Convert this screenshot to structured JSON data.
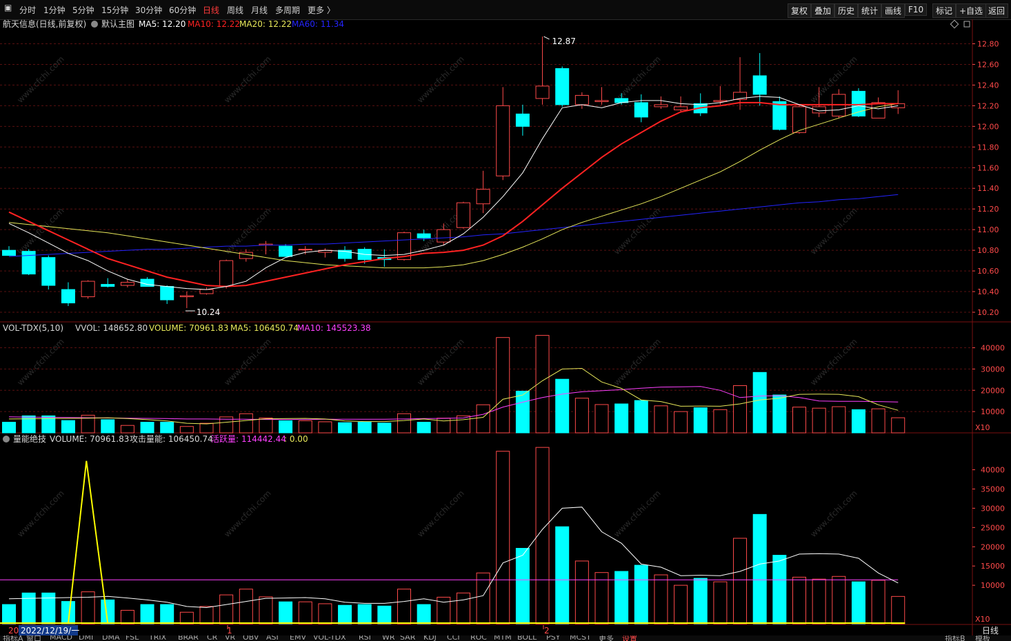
{
  "toolbar": {
    "periods": [
      "分时",
      "1分钟",
      "5分钟",
      "15分钟",
      "30分钟",
      "60分钟",
      "日线",
      "周线",
      "月线",
      "多周期",
      "更多 〉"
    ],
    "active_period": "日线",
    "right_buttons": [
      "复权",
      "叠加",
      "历史",
      "统计",
      "画线",
      "F10",
      "标记",
      "+自选",
      "返回"
    ]
  },
  "main_panel": {
    "stock_title": "航天信息(日线,前复权)",
    "chart_label": "默认主图",
    "ma5": "MA5: 12.20",
    "ma10": "MA10: 12.22",
    "ma20": "MA20: 12.22",
    "ma60": "MA60: 11.34",
    "high_marker": "12.87",
    "low_marker": "10.24",
    "y_ticks": [
      "12.80",
      "12.60",
      "12.40",
      "12.20",
      "12.00",
      "11.80",
      "11.60",
      "11.40",
      "11.20",
      "11.00",
      "10.80",
      "10.60",
      "10.40",
      "10.20"
    ]
  },
  "vol_panel": {
    "title": "VOL-TDX(5,10)",
    "vvol": "VVOL: 148652.80",
    "volume": "VOLUME: 70961.83",
    "ma5": "MA5: 106450.74",
    "ma10": "MA10: 145523.38",
    "y_ticks": [
      "40000",
      "30000",
      "20000",
      "10000"
    ],
    "unit": "X10"
  },
  "energy_panel": {
    "title": "量能绝技",
    "volume": "VOLUME: 70961.83",
    "attack": "攻击量能: 106450.74",
    "active_label": "活跃量: ",
    "active_value": "114442.44",
    "tail": ": 0.00",
    "y_ticks": [
      "40000",
      "35000",
      "30000",
      "25000",
      "20000",
      "15000",
      "10000"
    ],
    "unit": "X10"
  },
  "x_axis": {
    "left_edge": "20",
    "date_cursor": "2022/12/19/一",
    "mark_1": "1",
    "mark_2": "2",
    "period_label": "日线"
  },
  "bottom_tabs": [
    "指标A",
    "窗口",
    "MACD",
    "DMI",
    "DMA",
    "FSL",
    "TRIX",
    "BRAR",
    "CR",
    "VR",
    "OBV",
    "ASI",
    "EMV",
    "VOL-TDX",
    "RSI",
    "WR",
    "SAR",
    "KDJ",
    "CCI",
    "ROC",
    "MTM",
    "BOLL",
    "PSY",
    "MCST",
    "更多",
    "设置"
  ],
  "bottom_right": [
    "指标B",
    "模板"
  ],
  "watermark": "www.cfchi.com",
  "colors": {
    "up": "#ff4a4a",
    "down": "#00ffff",
    "ma5": "#ffffff",
    "ma10": "#ff2222",
    "ma20": "#e8e85a",
    "ma60": "#2424ff",
    "vol_ma10": "#ff40ff",
    "bg": "#000000"
  },
  "chart_data": {
    "type": "candlestick",
    "price_ylim": [
      10.1,
      12.93
    ],
    "candles": [
      {
        "o": 10.8,
        "h": 10.84,
        "l": 10.75,
        "c": 10.75
      },
      {
        "o": 10.79,
        "h": 10.81,
        "l": 10.56,
        "c": 10.57
      },
      {
        "o": 10.73,
        "h": 10.75,
        "l": 10.42,
        "c": 10.46
      },
      {
        "o": 10.42,
        "h": 10.49,
        "l": 10.26,
        "c": 10.29
      },
      {
        "o": 10.35,
        "h": 10.51,
        "l": 10.33,
        "c": 10.5
      },
      {
        "o": 10.47,
        "h": 10.53,
        "l": 10.44,
        "c": 10.45
      },
      {
        "o": 10.46,
        "h": 10.52,
        "l": 10.44,
        "c": 10.49
      },
      {
        "o": 10.52,
        "h": 10.54,
        "l": 10.45,
        "c": 10.45
      },
      {
        "o": 10.45,
        "h": 10.46,
        "l": 10.28,
        "c": 10.32
      },
      {
        "o": 10.35,
        "h": 10.4,
        "l": 10.24,
        "c": 10.36
      },
      {
        "o": 10.38,
        "h": 10.44,
        "l": 10.37,
        "c": 10.42
      },
      {
        "o": 10.45,
        "h": 10.71,
        "l": 10.43,
        "c": 10.7
      },
      {
        "o": 10.72,
        "h": 10.81,
        "l": 10.69,
        "c": 10.78
      },
      {
        "o": 10.85,
        "h": 10.89,
        "l": 10.76,
        "c": 10.86
      },
      {
        "o": 10.84,
        "h": 10.86,
        "l": 10.74,
        "c": 10.74
      },
      {
        "o": 10.81,
        "h": 10.84,
        "l": 10.76,
        "c": 10.81
      },
      {
        "o": 10.78,
        "h": 10.82,
        "l": 10.73,
        "c": 10.8
      },
      {
        "o": 10.8,
        "h": 10.84,
        "l": 10.69,
        "c": 10.72
      },
      {
        "o": 10.81,
        "h": 10.83,
        "l": 10.67,
        "c": 10.71
      },
      {
        "o": 10.73,
        "h": 10.81,
        "l": 10.64,
        "c": 10.71
      },
      {
        "o": 10.71,
        "h": 10.98,
        "l": 10.7,
        "c": 10.97
      },
      {
        "o": 10.96,
        "h": 11.0,
        "l": 10.89,
        "c": 10.92
      },
      {
        "o": 10.88,
        "h": 11.06,
        "l": 10.85,
        "c": 11.0
      },
      {
        "o": 11.02,
        "h": 11.27,
        "l": 11.01,
        "c": 11.26
      },
      {
        "o": 11.25,
        "h": 11.57,
        "l": 11.16,
        "c": 11.39
      },
      {
        "o": 11.52,
        "h": 12.38,
        "l": 11.48,
        "c": 12.2
      },
      {
        "o": 12.12,
        "h": 12.21,
        "l": 11.91,
        "c": 12.0
      },
      {
        "o": 12.27,
        "h": 12.87,
        "l": 12.21,
        "c": 12.39
      },
      {
        "o": 12.56,
        "h": 12.58,
        "l": 12.19,
        "c": 12.21
      },
      {
        "o": 12.21,
        "h": 12.33,
        "l": 12.17,
        "c": 12.3
      },
      {
        "o": 12.24,
        "h": 12.38,
        "l": 12.21,
        "c": 12.25
      },
      {
        "o": 12.27,
        "h": 12.32,
        "l": 12.21,
        "c": 12.23
      },
      {
        "o": 12.23,
        "h": 12.31,
        "l": 12.04,
        "c": 12.09
      },
      {
        "o": 12.19,
        "h": 12.29,
        "l": 12.17,
        "c": 12.21
      },
      {
        "o": 12.16,
        "h": 12.29,
        "l": 12.14,
        "c": 12.19
      },
      {
        "o": 12.22,
        "h": 12.32,
        "l": 12.1,
        "c": 12.13
      },
      {
        "o": 12.24,
        "h": 12.39,
        "l": 12.21,
        "c": 12.25
      },
      {
        "o": 12.26,
        "h": 12.67,
        "l": 12.16,
        "c": 12.33
      },
      {
        "o": 12.49,
        "h": 12.71,
        "l": 12.2,
        "c": 12.31
      },
      {
        "o": 12.24,
        "h": 12.29,
        "l": 11.96,
        "c": 11.97
      },
      {
        "o": 11.94,
        "h": 12.2,
        "l": 11.93,
        "c": 12.19
      },
      {
        "o": 12.13,
        "h": 12.38,
        "l": 12.09,
        "c": 12.19
      },
      {
        "o": 12.1,
        "h": 12.36,
        "l": 12.08,
        "c": 12.31
      },
      {
        "o": 12.34,
        "h": 12.37,
        "l": 12.09,
        "c": 12.1
      },
      {
        "o": 12.08,
        "h": 12.28,
        "l": 12.08,
        "c": 12.23
      },
      {
        "o": 12.18,
        "h": 12.35,
        "l": 12.12,
        "c": 12.22
      }
    ],
    "ma5": [
      11.06,
      10.97,
      10.87,
      10.77,
      10.7,
      10.6,
      10.52,
      10.47,
      10.45,
      10.43,
      10.42,
      10.45,
      10.5,
      10.63,
      10.73,
      10.78,
      10.8,
      10.79,
      10.76,
      10.75,
      10.76,
      10.8,
      10.85,
      10.96,
      11.12,
      11.32,
      11.55,
      11.88,
      12.18,
      12.21,
      12.18,
      12.23,
      12.25,
      12.25,
      12.22,
      12.21,
      12.23,
      12.27,
      12.29,
      12.28,
      12.21,
      12.15,
      12.16,
      12.2,
      12.17,
      12.2
    ],
    "ma10": [
      11.17,
      11.08,
      10.99,
      10.9,
      10.81,
      10.72,
      10.66,
      10.6,
      10.54,
      10.5,
      10.46,
      10.45,
      10.46,
      10.5,
      10.54,
      10.58,
      10.62,
      10.66,
      10.69,
      10.72,
      10.74,
      10.77,
      10.78,
      10.8,
      10.85,
      10.94,
      11.08,
      11.24,
      11.4,
      11.55,
      11.7,
      11.83,
      11.94,
      12.05,
      12.14,
      12.18,
      12.2,
      12.23,
      12.23,
      12.21,
      12.21,
      12.21,
      12.21,
      12.21,
      12.22,
      12.22
    ],
    "ma20": [
      11.07,
      11.05,
      11.03,
      11.01,
      10.99,
      10.97,
      10.94,
      10.91,
      10.88,
      10.85,
      10.82,
      10.79,
      10.76,
      10.73,
      10.7,
      10.68,
      10.66,
      10.65,
      10.64,
      10.63,
      10.63,
      10.63,
      10.64,
      10.66,
      10.7,
      10.76,
      10.83,
      10.91,
      11.0,
      11.07,
      11.13,
      11.19,
      11.25,
      11.32,
      11.4,
      11.48,
      11.56,
      11.66,
      11.77,
      11.87,
      11.96,
      12.02,
      12.08,
      12.14,
      12.19,
      12.22
    ],
    "ma60": [
      10.74,
      10.75,
      10.76,
      10.77,
      10.78,
      10.79,
      10.8,
      10.81,
      10.81,
      10.82,
      10.83,
      10.84,
      10.84,
      10.85,
      10.85,
      10.86,
      10.86,
      10.87,
      10.88,
      10.89,
      10.9,
      10.91,
      10.92,
      10.93,
      10.95,
      10.96,
      10.98,
      11.0,
      11.02,
      11.04,
      11.06,
      11.08,
      11.1,
      11.12,
      11.14,
      11.16,
      11.18,
      11.2,
      11.22,
      11.24,
      11.26,
      11.27,
      11.29,
      11.3,
      11.32,
      11.34
    ],
    "volume": [
      5000,
      8000,
      8000,
      5800,
      8300,
      6200,
      3500,
      5000,
      5000,
      3000,
      4500,
      7500,
      9000,
      7000,
      5700,
      5700,
      5200,
      4800,
      5000,
      4600,
      9000,
      5000,
      6900,
      8000,
      13200,
      44800,
      19600,
      45800,
      25200,
      16300,
      13300,
      13600,
      15200,
      12700,
      10000,
      11800,
      10900,
      22200,
      28400,
      17800,
      12100,
      11600,
      12300,
      10900,
      11300,
      7100
    ],
    "vol_ma5": [
      6500,
      6600,
      6700,
      6800,
      6900,
      7100,
      6700,
      6200,
      5600,
      4500,
      4200,
      5000,
      5800,
      6600,
      6700,
      6800,
      6500,
      5600,
      5300,
      5300,
      5800,
      6500,
      5600,
      6200,
      7300,
      15800,
      17800,
      24500,
      30000,
      30300,
      23900,
      20900,
      15500,
      14700,
      12500,
      12600,
      12500,
      13600,
      15500,
      16300,
      18100,
      18200,
      18100,
      17000,
      13200,
      10600
    ],
    "vol_ma10": [
      7500,
      7400,
      7300,
      7200,
      7100,
      7000,
      6900,
      6800,
      6700,
      6500,
      6500,
      6400,
      6400,
      6300,
      6300,
      6300,
      6400,
      6400,
      6400,
      6400,
      6500,
      6700,
      6800,
      7000,
      8700,
      12100,
      14400,
      16600,
      18200,
      19300,
      19800,
      20300,
      21000,
      21500,
      21600,
      21800,
      20000,
      16600,
      17300,
      17500,
      16600,
      15000,
      14800,
      14800,
      14700,
      14500
    ],
    "vol_ylim": [
      0,
      46000
    ],
    "energy_ylim": [
      0,
      46000
    ],
    "energy_active": 11400,
    "energy_spike": {
      "index": 4,
      "value": 42300
    }
  }
}
